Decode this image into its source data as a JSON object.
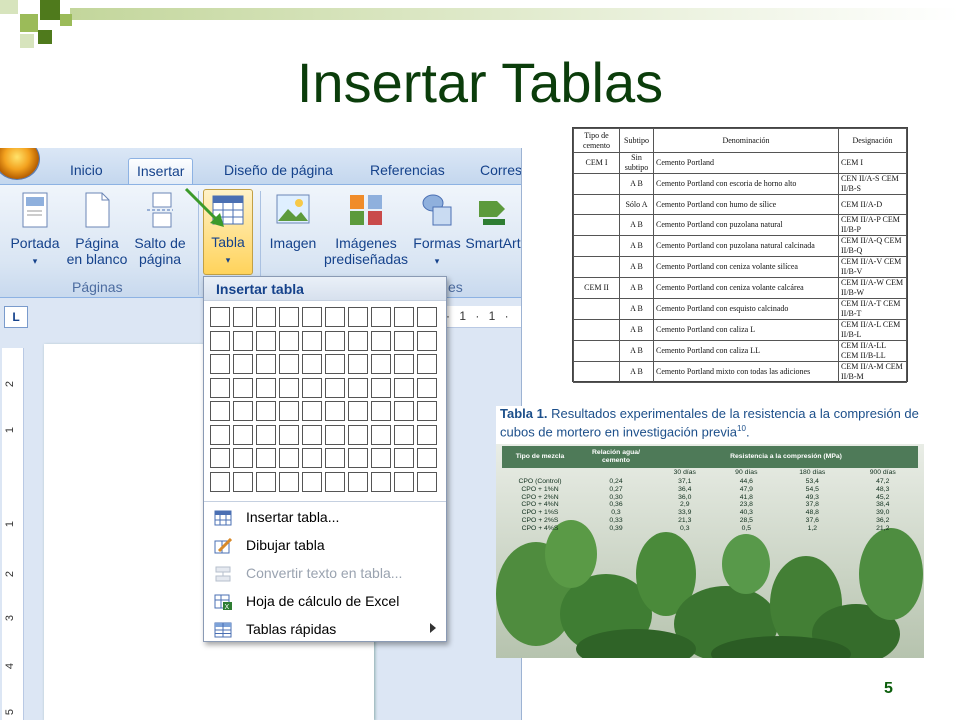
{
  "slide": {
    "title": "Insertar Tablas",
    "page_number": "5"
  },
  "word": {
    "tabs": [
      "Inicio",
      "Insertar",
      "Diseño de página",
      "Referencias",
      "Corres"
    ],
    "active_tab": "Insertar",
    "ribbon_buttons": {
      "portada": [
        "Portada"
      ],
      "pagina_en_blanco": [
        "Página",
        "en blanco"
      ],
      "salto_de_pagina": [
        "Salto de",
        "página"
      ],
      "tabla": [
        "Tabla"
      ],
      "imagen": [
        "Imagen"
      ],
      "imagenes_prediseñadas": [
        "Imágenes",
        "prediseñadas"
      ],
      "formas": [
        "Formas"
      ],
      "smartart": [
        "SmartArt"
      ]
    },
    "group_labels": {
      "paginas": "Páginas",
      "ilustraciones_partial": "es"
    },
    "ruler_corner": "L",
    "hruler_text": "· 1 · 1 ·",
    "vruler_marks": [
      "2",
      "1",
      "1",
      "2",
      "3",
      "4",
      "5"
    ],
    "dropdown": {
      "header": "Insertar tabla",
      "grid": {
        "cols": 10,
        "rows": 8
      },
      "items": [
        {
          "label": "Insertar tabla...",
          "enabled": true,
          "icon": "table-icon"
        },
        {
          "label": "Dibujar tabla",
          "enabled": true,
          "icon": "pencil-table-icon"
        },
        {
          "label": "Convertir texto en tabla...",
          "enabled": false,
          "icon": "convert-text-icon"
        },
        {
          "label": "Hoja de cálculo de Excel",
          "enabled": true,
          "icon": "excel-icon"
        },
        {
          "label": "Tablas rápidas",
          "enabled": true,
          "icon": "quick-tables-icon",
          "submenu": true
        }
      ]
    }
  },
  "table1": {
    "headers": [
      "Tipo de cemento",
      "Subtipo",
      "Denominación",
      "Designación"
    ],
    "rows": [
      [
        "CEM I",
        "Sin subtipo",
        "Cemento Portland",
        "CEM I"
      ],
      [
        "",
        "A B",
        "Cemento Portland con escoria de horno alto",
        "CEN II/A-S CEM II/B-S"
      ],
      [
        "",
        "Sólo A",
        "Cemento Portland con humo de sílice",
        "CEM II/A-D"
      ],
      [
        "",
        "A B",
        "Cemento Portland con puzolana natural",
        "CEM II/A-P CEM II/B-P"
      ],
      [
        "",
        "A B",
        "Cemento Portland con puzolana natural calcinada",
        "CEM II/A-Q CEM II/B-Q"
      ],
      [
        "",
        "A B",
        "Cemento Portland con ceniza volante silícea",
        "CEM II/A-V CEM II/B-V"
      ],
      [
        "CEM II",
        "A B",
        "Cemento Portland con ceniza volante calcárea",
        "CEM II/A-W CEM II/B-W"
      ],
      [
        "",
        "A B",
        "Cemento Portland con esquisto calcinado",
        "CEM II/A-T CEM II/B-T"
      ],
      [
        "",
        "A B",
        "Cemento Portland con caliza L",
        "CEM II/A-L CEM II/B-L"
      ],
      [
        "",
        "A B",
        "Cemento Portland con caliza LL",
        "CEM II/A-LL CEM II/B-LL"
      ],
      [
        "",
        "A B",
        "Cemento Portland mixto con todas las adiciones",
        "CEM II/A-M CEM II/B-M"
      ]
    ]
  },
  "table2": {
    "title_bold": "Tabla 1.",
    "title_rest": "Resultados experimentales de la resistencia a la compresión de cubos de mortero en investigación previa",
    "title_sup": "10",
    "headers": [
      "Tipo de mezcla",
      "Relación agua/ cemento",
      "Resistencia a la compresión (MPa)"
    ],
    "subheaders": [
      "30 días",
      "90 días",
      "180 días",
      "900 días"
    ],
    "rows": [
      [
        "CPO (Control)",
        "0,24",
        "37,1",
        "44,6",
        "53,4",
        "47,2"
      ],
      [
        "CPO + 1%N",
        "0,27",
        "36,4",
        "47,9",
        "54,5",
        "48,3"
      ],
      [
        "CPO + 2%N",
        "0,30",
        "36,0",
        "41,8",
        "49,3",
        "45,2"
      ],
      [
        "CPO + 4%N",
        "0,36",
        "2,9",
        "23,8",
        "37,8",
        "38,4"
      ],
      [
        "CPO + 1%S",
        "0,3",
        "33,9",
        "40,3",
        "48,8",
        "39,0"
      ],
      [
        "CPO + 2%S",
        "0,33",
        "21,3",
        "28,5",
        "37,6",
        "36,2"
      ],
      [
        "CPO + 4%S",
        "0,39",
        "0,3",
        "0,5",
        "1,2",
        "21,2"
      ]
    ]
  },
  "colors": {
    "title": "#0b3d0b",
    "deco_dark": "#4f7a1c",
    "deco_light": "#9bbb59",
    "word_blue": "#15428b",
    "highlight": "#ffd35b"
  }
}
